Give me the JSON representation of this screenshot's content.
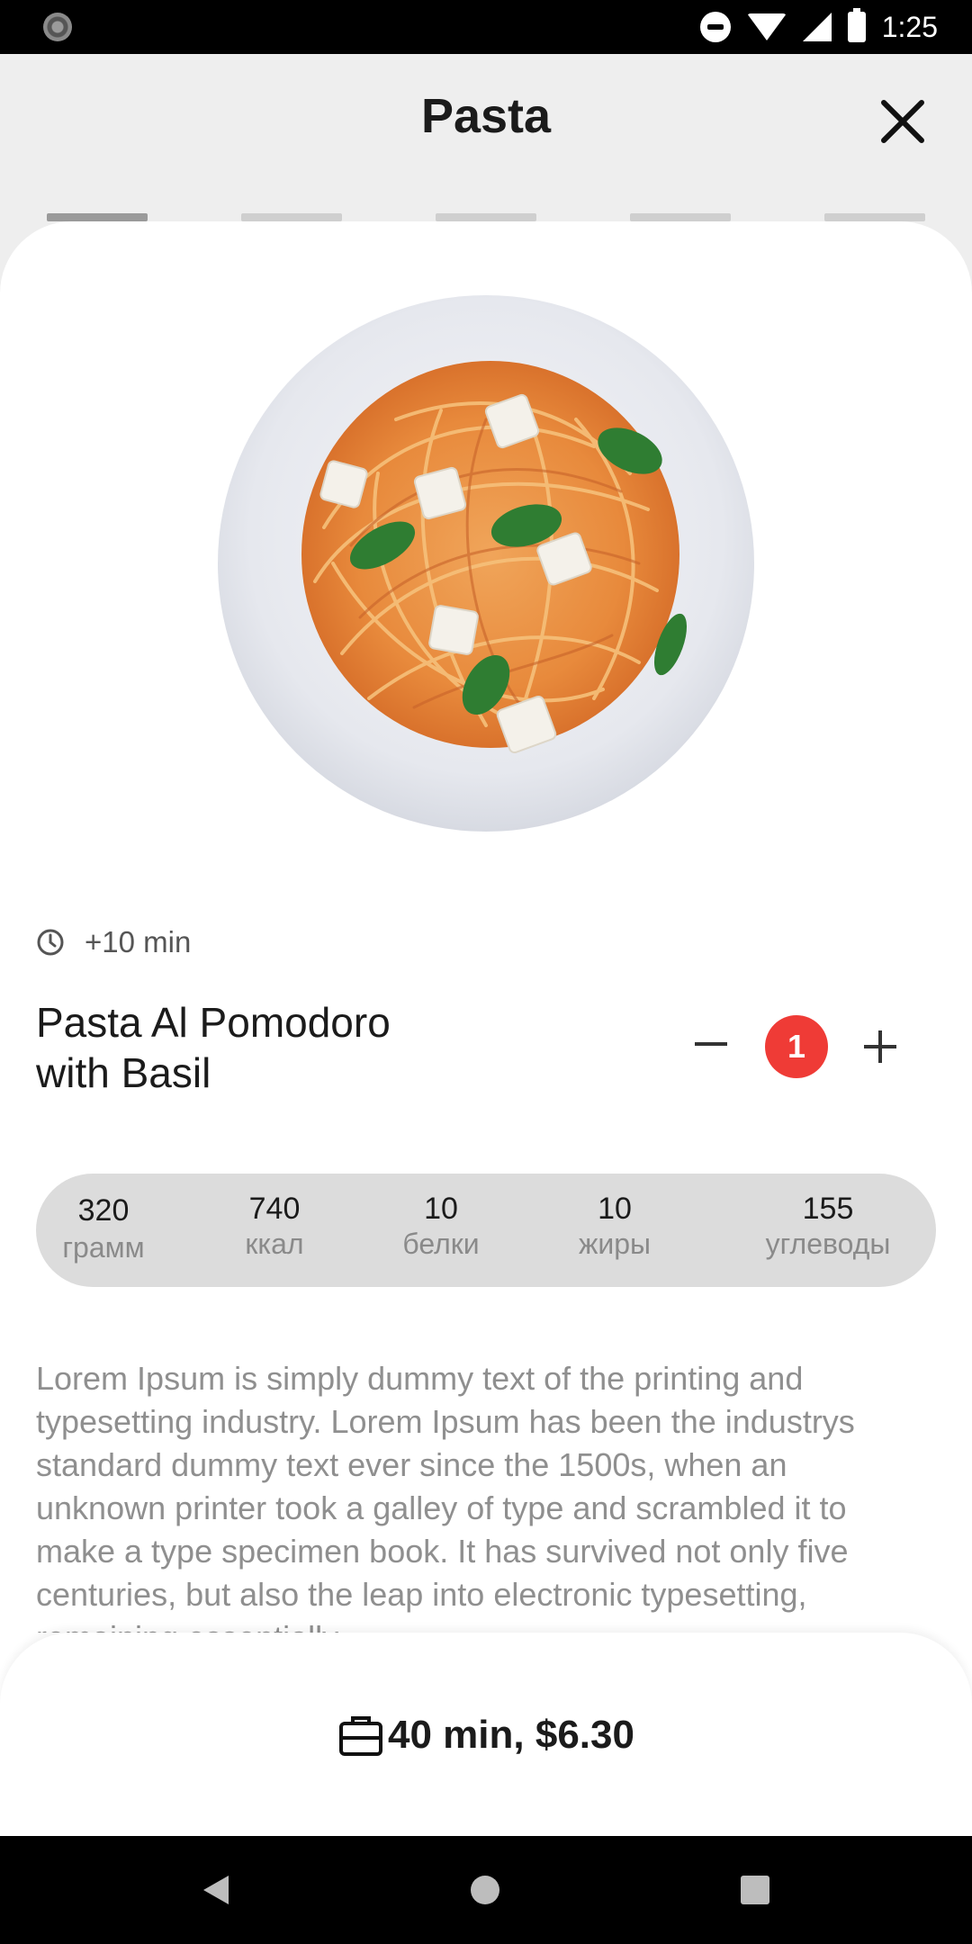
{
  "status_bar": {
    "time": "1:25",
    "icons": [
      "notification-icon",
      "do-not-disturb-icon",
      "wifi-icon",
      "signal-icon",
      "battery-icon"
    ]
  },
  "header": {
    "title": "Pasta",
    "close_icon": "close-icon"
  },
  "steps": {
    "count": 5,
    "active_index": 0
  },
  "dish": {
    "image": "pasta-dish-image",
    "extra_time": "+10 min",
    "name_line1": "Pasta Al Pomodoro",
    "name_line2": "with Basil",
    "quantity": "1"
  },
  "nutrition": [
    {
      "value": "320",
      "label": "грамм"
    },
    {
      "value": "740",
      "label": "ккал"
    },
    {
      "value": "10",
      "label": "белки"
    },
    {
      "value": "10",
      "label": "жиры"
    },
    {
      "value": "155",
      "label": "углеводы"
    }
  ],
  "description": "Lorem Ipsum is simply dummy text of the printing and typesetting industry. Lorem Ipsum has been the industrys standard dummy text ever since the 1500s, when an unknown printer took a galley of type and scrambled it to make a type specimen book. It has survived not only five centuries, but also the leap into electronic typesetting, remaining essentially",
  "order": {
    "icon": "bag-icon",
    "label": "40 min, $6.30"
  },
  "colors": {
    "accent": "#ef3b36",
    "background": "#eeeeee",
    "card": "#ffffff",
    "pill": "#dcdcdc"
  }
}
